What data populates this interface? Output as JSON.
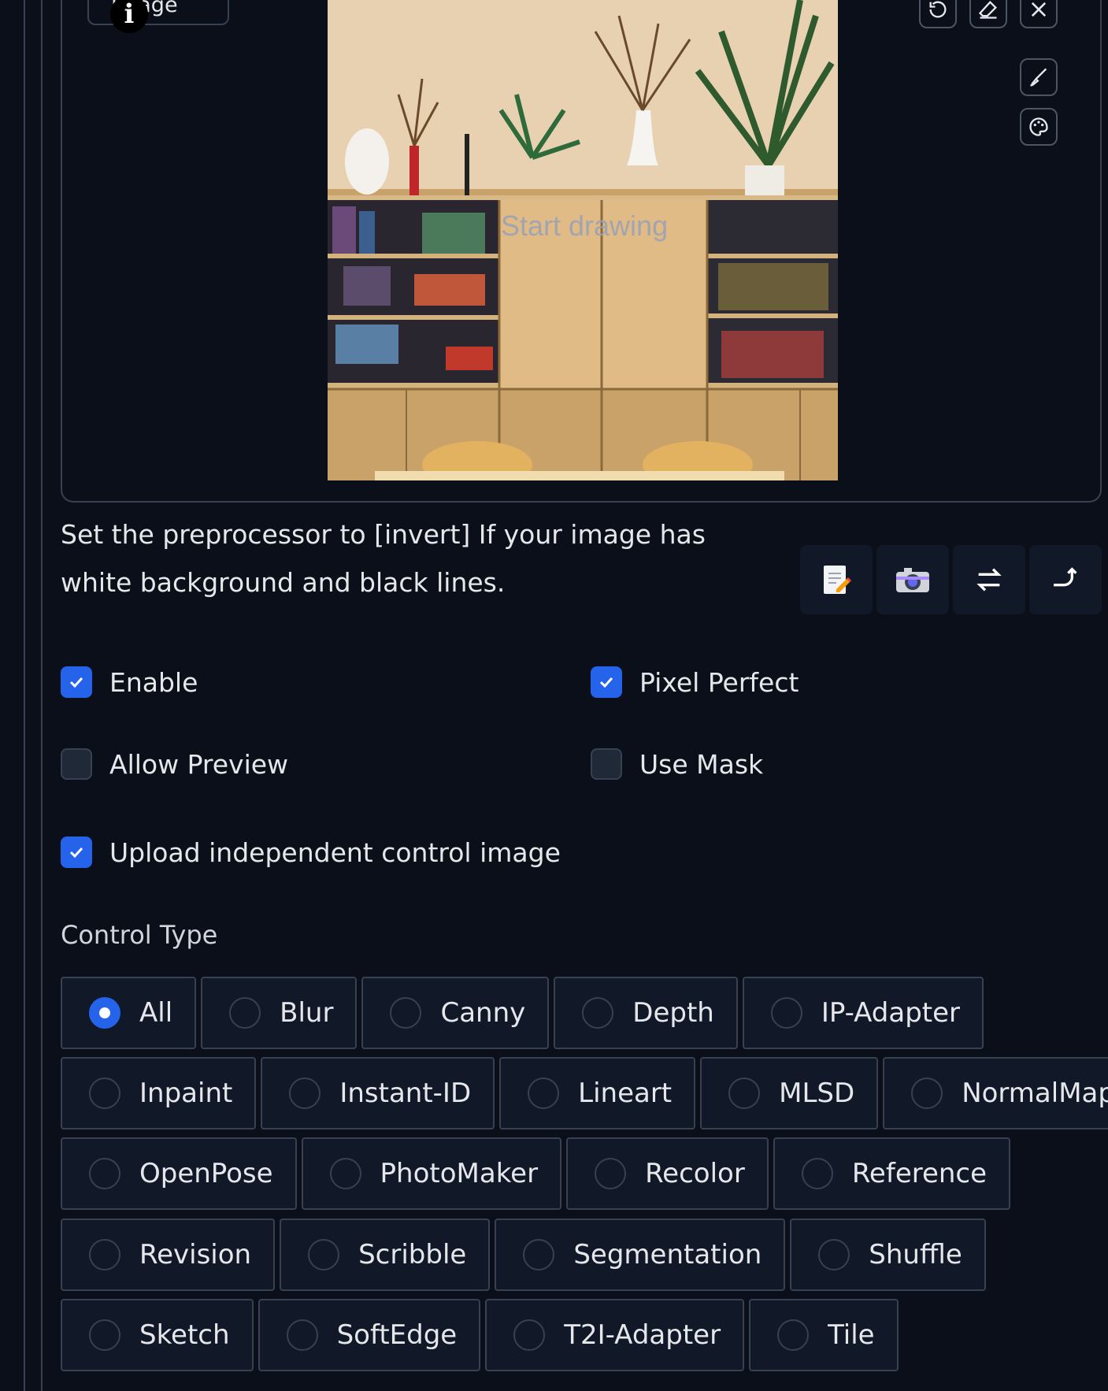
{
  "image_panel": {
    "label": "Image",
    "canvas_placeholder": "Start drawing"
  },
  "hint_text": "Set the preprocessor to [invert] If your image has white background and black lines.",
  "checkboxes": {
    "enable": {
      "label": "Enable",
      "checked": true
    },
    "pixel_perfect": {
      "label": "Pixel Perfect",
      "checked": true
    },
    "allow_preview": {
      "label": "Allow Preview",
      "checked": false
    },
    "use_mask": {
      "label": "Use Mask",
      "checked": false
    },
    "upload_independent": {
      "label": "Upload independent control image",
      "checked": true
    }
  },
  "control_type": {
    "label": "Control Type",
    "selected": "All",
    "rows": [
      [
        "All",
        "Blur",
        "Canny",
        "Depth",
        "IP-Adapter"
      ],
      [
        "Inpaint",
        "Instant-ID",
        "Lineart",
        "MLSD",
        "NormalMap"
      ],
      [
        "OpenPose",
        "PhotoMaker",
        "Recolor",
        "Reference"
      ],
      [
        "Revision",
        "Scribble",
        "Segmentation",
        "Shuffle"
      ],
      [
        "Sketch",
        "SoftEdge",
        "T2I-Adapter",
        "Tile"
      ]
    ]
  },
  "colors": {
    "background": "#0b0f19",
    "border": "#374151",
    "accent": "#2563eb"
  }
}
